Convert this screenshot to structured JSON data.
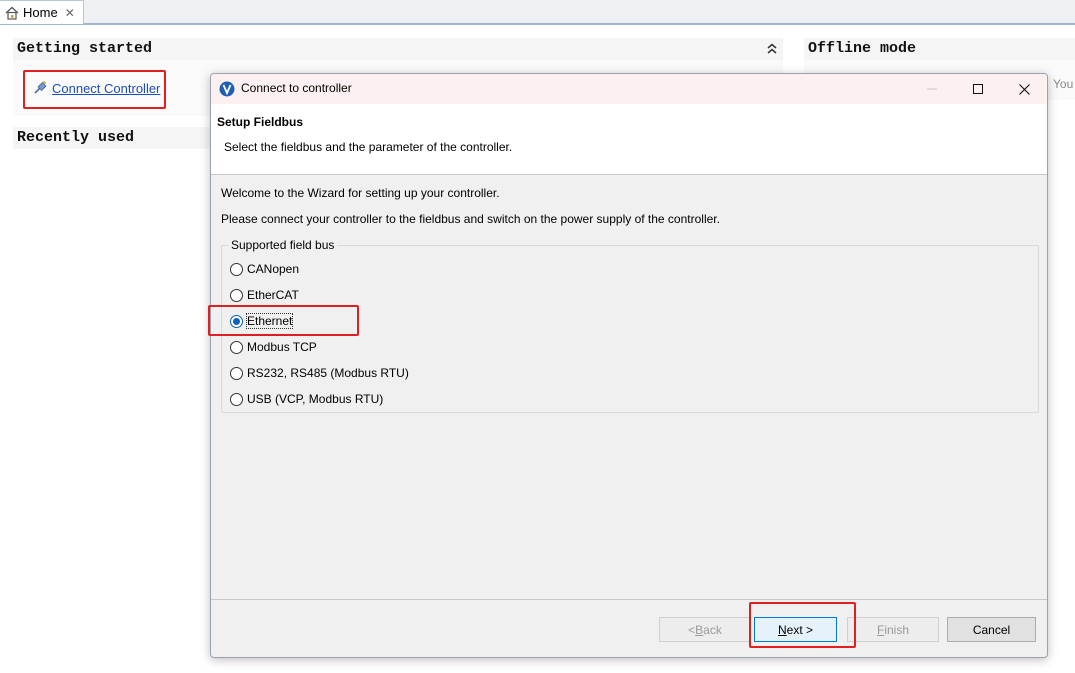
{
  "tab": {
    "label": "Home",
    "close": "✕"
  },
  "welcome_page": {
    "getting_started": {
      "title": "Getting started",
      "collapse_icon": "⌃⌃"
    },
    "connect_link": "Connect Controller",
    "recently_used": {
      "title": "Recently used"
    },
    "offline_mode": {
      "title": "Offline mode",
      "partial_text": "You"
    }
  },
  "dialog": {
    "title": "Connect to controller",
    "header": {
      "title": "Setup Fieldbus",
      "description": "Select the fieldbus and the parameter of the controller."
    },
    "welcome_text": "Welcome to the Wizard for setting up your controller.",
    "instruction_text": "Please connect your controller to the fieldbus and switch on the power supply of the controller.",
    "group_label": "Supported field bus",
    "options": [
      {
        "label": "CANopen",
        "selected": false
      },
      {
        "label": "EtherCAT",
        "selected": false
      },
      {
        "label": "Ethernet",
        "selected": true
      },
      {
        "label": "Modbus TCP",
        "selected": false
      },
      {
        "label": "RS232, RS485 (Modbus RTU)",
        "selected": false
      },
      {
        "label": "USB (VCP, Modbus RTU)",
        "selected": false
      }
    ],
    "buttons": {
      "back_prefix": "< ",
      "back_mnemonic": "B",
      "back_rest": "ack",
      "next_mnemonic": "N",
      "next_rest": "ext >",
      "finish_mnemonic": "F",
      "finish_rest": "inish",
      "cancel": "Cancel"
    }
  },
  "colors": {
    "highlight_box": "#e02020",
    "link": "#1a4fb8",
    "radio_selected": "#0b5fbf"
  }
}
